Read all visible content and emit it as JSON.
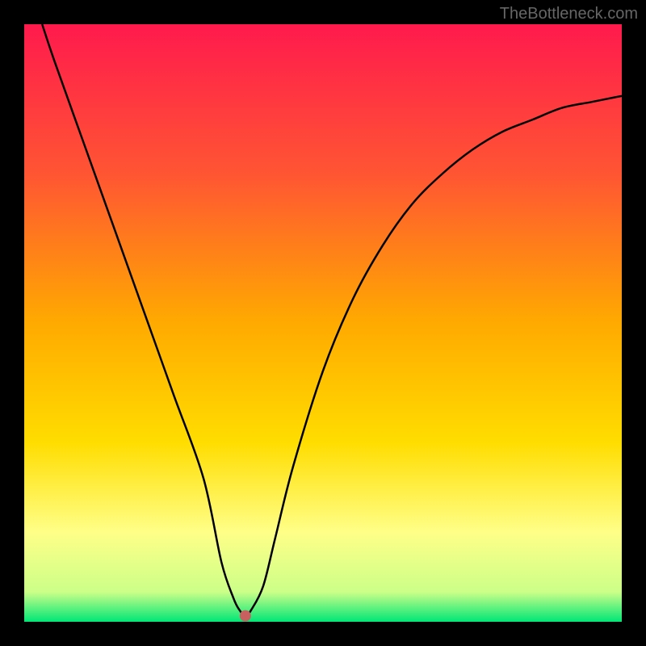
{
  "watermark": "TheBottleneck.com",
  "chart_data": {
    "type": "line",
    "title": "",
    "xlabel": "",
    "ylabel": "",
    "xlim": [
      0,
      100
    ],
    "ylim": [
      0,
      100
    ],
    "gradient_stops": [
      {
        "offset": 0,
        "color": "#ff1a4d"
      },
      {
        "offset": 25,
        "color": "#ff5533"
      },
      {
        "offset": 50,
        "color": "#ffaa00"
      },
      {
        "offset": 70,
        "color": "#ffdd00"
      },
      {
        "offset": 85,
        "color": "#ffff88"
      },
      {
        "offset": 95,
        "color": "#ccff88"
      },
      {
        "offset": 100,
        "color": "#00e676"
      }
    ],
    "series": [
      {
        "name": "bottleneck-curve",
        "x": [
          3,
          5,
          10,
          15,
          20,
          25,
          30,
          33,
          35,
          36,
          37,
          38,
          40,
          42,
          45,
          50,
          55,
          60,
          65,
          70,
          75,
          80,
          85,
          90,
          95,
          100
        ],
        "values": [
          100,
          94,
          80,
          66,
          52,
          38,
          24,
          10,
          4,
          2,
          1,
          2,
          6,
          14,
          26,
          42,
          54,
          63,
          70,
          75,
          79,
          82,
          84,
          86,
          87,
          88
        ]
      }
    ],
    "marker": {
      "x": 37,
      "y": 1,
      "color": "#c86060"
    },
    "annotations": []
  }
}
